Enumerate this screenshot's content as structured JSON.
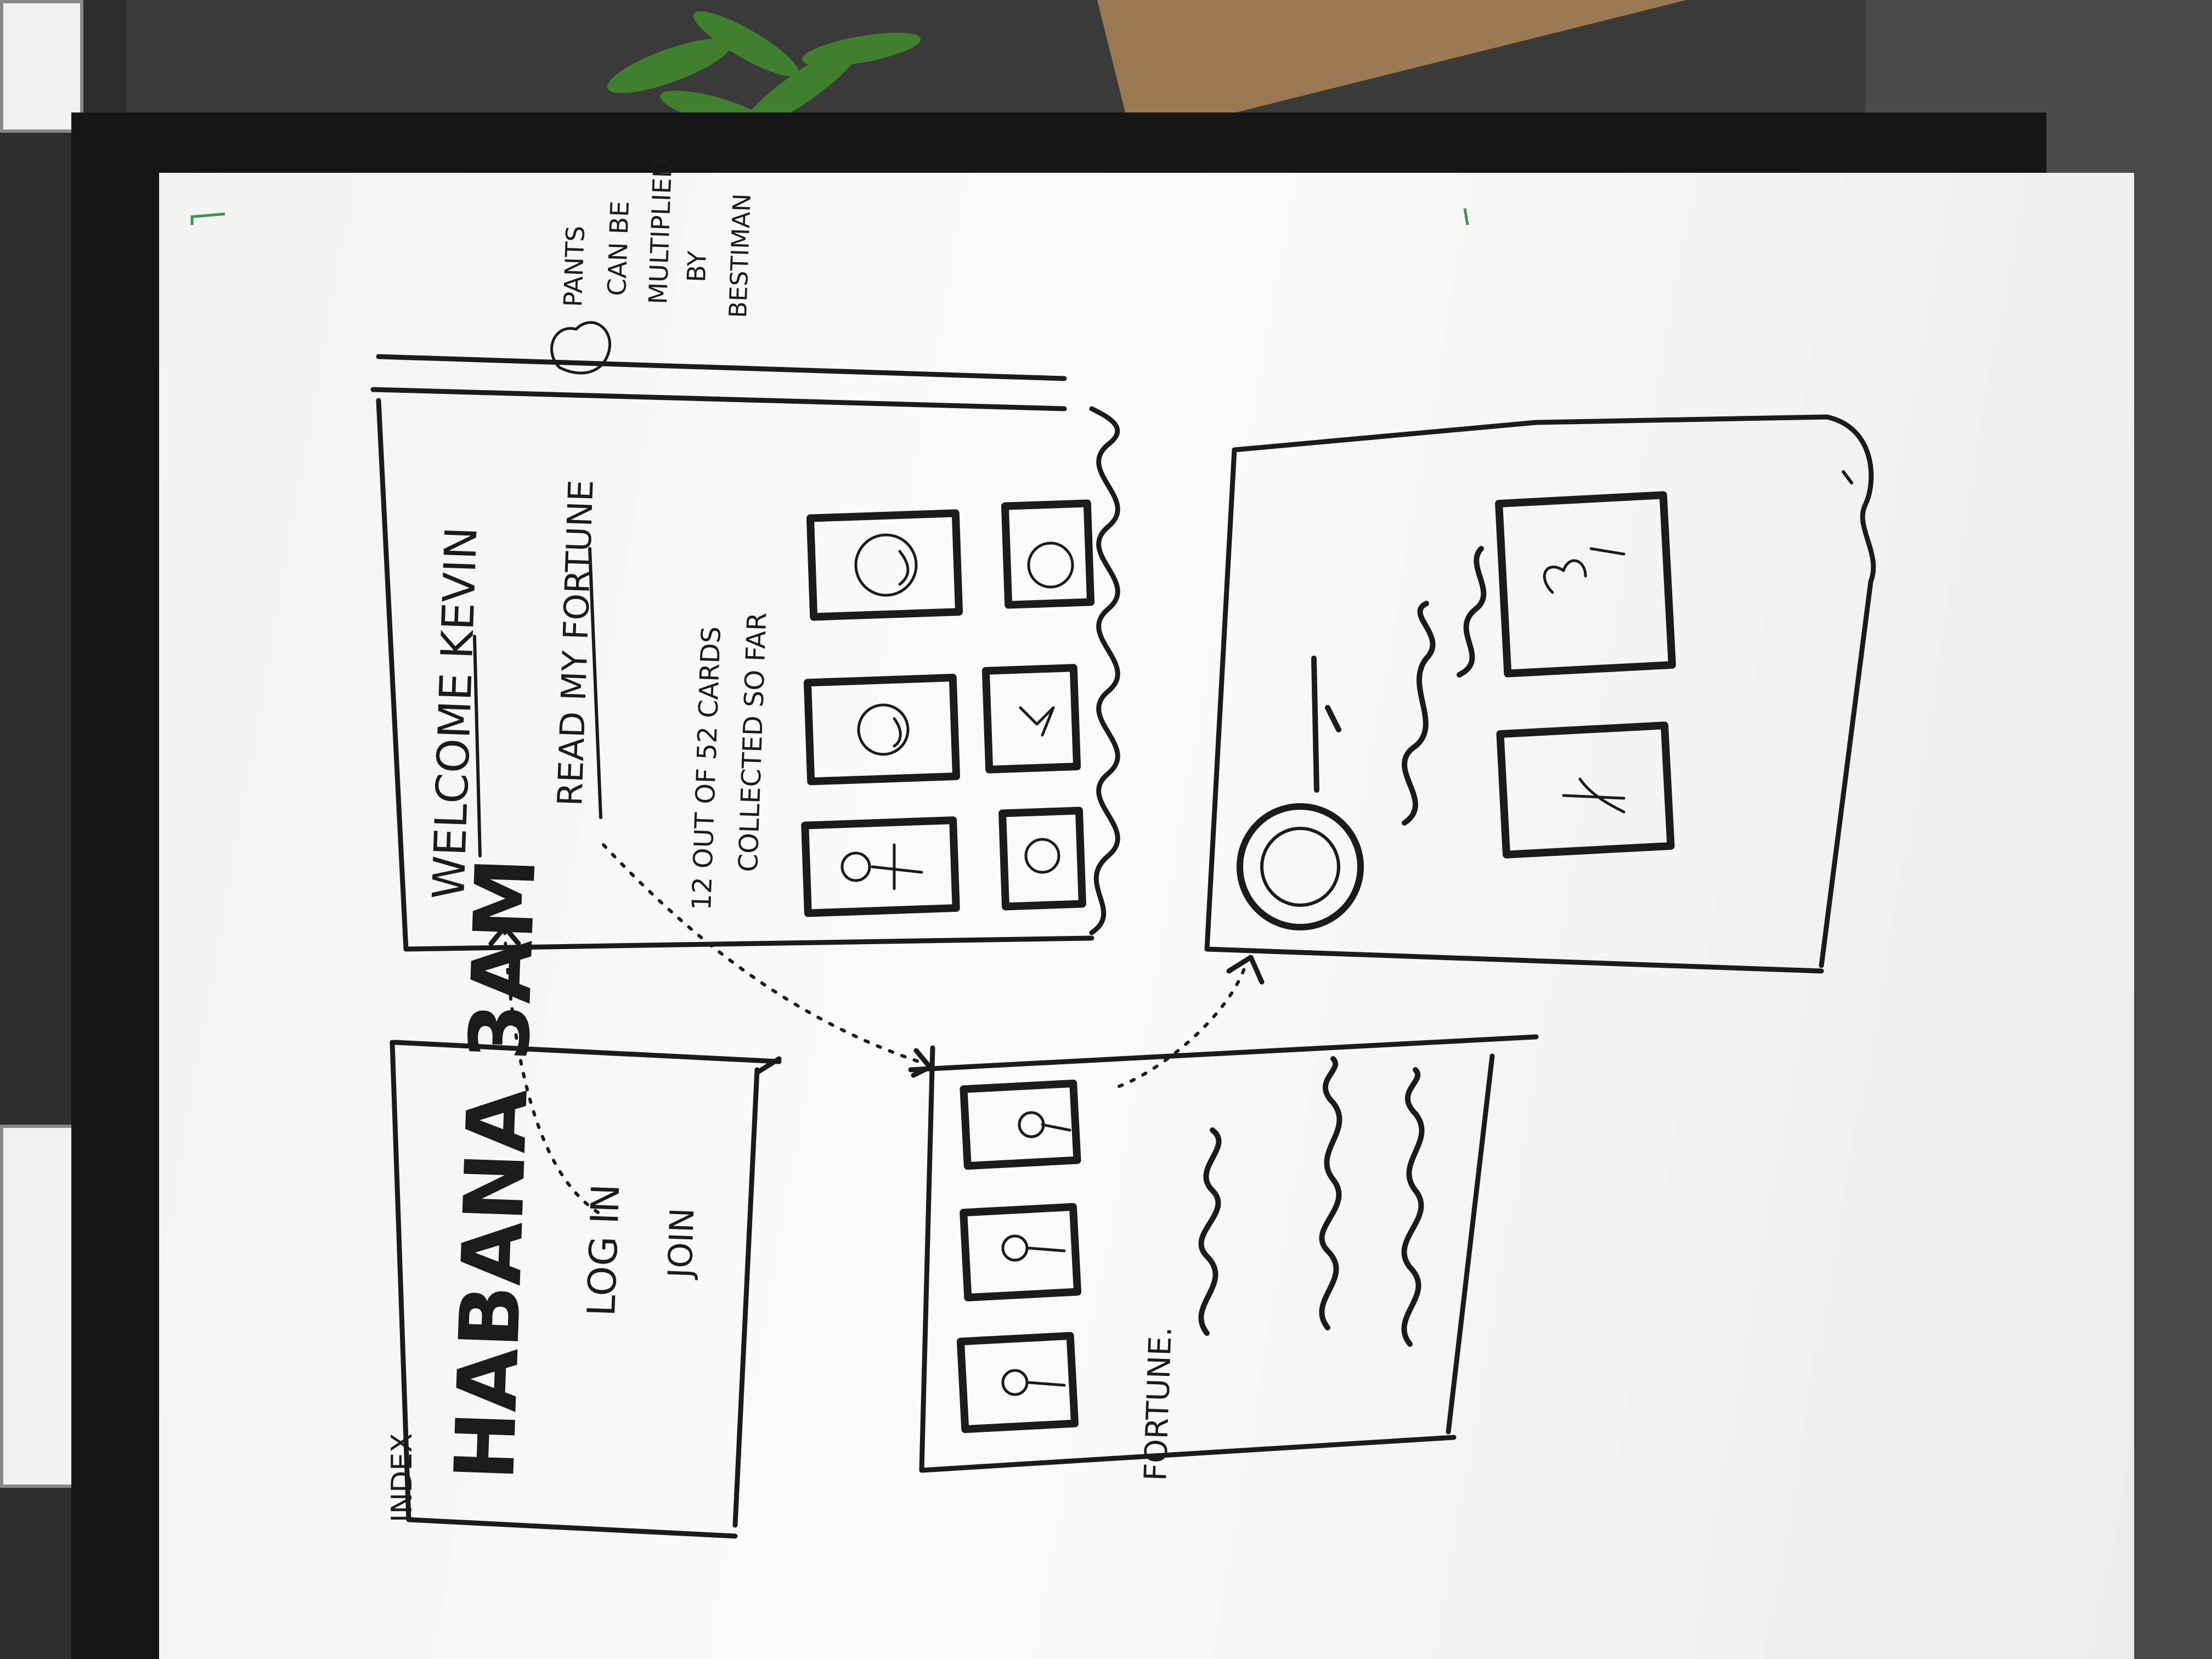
{
  "index_label": "INDEX",
  "title": "HABANA 3AM",
  "login": "LOG IN",
  "join": "JOIN",
  "welcome": "WELCOME KEVIN",
  "read_fortune": "READ MY FORTUNE",
  "cards_line1": "12 OUT OF 52 CARDS",
  "cards_line2": "COLLECTED SO FAR",
  "fortune": "FORTUNE.",
  "note": [
    "PANTS",
    "CAN BE",
    "MULTIPLIED",
    "BY",
    "BESTIMAN"
  ],
  "ink_color": "#1b1b1b",
  "marker_green": "#3f8f57"
}
